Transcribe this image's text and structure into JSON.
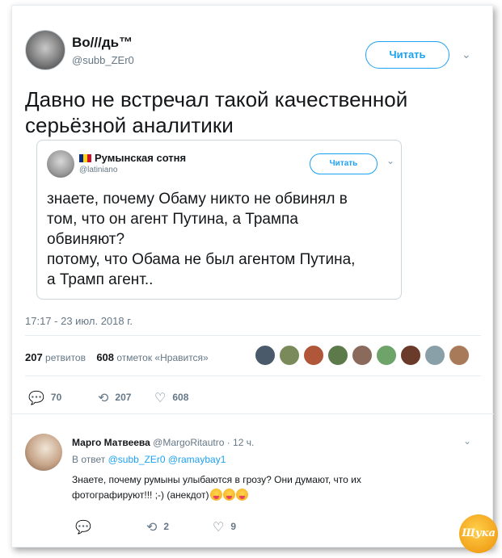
{
  "tweet": {
    "author_name": "Во///дь™",
    "author_handle": "@subb_ZEr0",
    "follow_label": "Читать",
    "text": "Давно не встречал такой качественной серьёзной аналитики",
    "timestamp": "17:17 - 23 июл. 2018 г.",
    "retweets_count": "207",
    "retweets_label": "ретвитов",
    "likes_count": "608",
    "likes_label": "отметок «Нравится»",
    "actions": {
      "reply_count": "70",
      "retweet_count": "207",
      "like_count": "608"
    }
  },
  "quoted": {
    "author_name": "Румынская сотня",
    "author_handle": "@latiniano",
    "follow_label": "Читать",
    "text_line1": "знаете, почему Обаму никто не обвинял в",
    "text_line2": "том, что он агент Путина, а Трампа",
    "text_line3": "обвиняют?",
    "text_line4": "потому, что Обама не был агентом Путина,",
    "text_line5": "а Трамп агент.."
  },
  "reply": {
    "author_name": "Марго Матвеева",
    "author_handle": "@MargoRitautro",
    "time": "· 12 ч.",
    "reply_to_label": "В ответ",
    "reply_to_handles": "@subb_ZEr0 @ramaybay1",
    "text_line1": "Знаете, почему румыны улыбаются в грозу? Они думают, что их",
    "text_line2": "фотографируют!!! ;-) (анекдот)",
    "retweet_count": "2",
    "like_count": "9"
  },
  "watermark": "Щука",
  "colors": {
    "accent": "#1da1f2",
    "muted": "#657786",
    "text": "#14171a",
    "border": "#e6ecf0"
  }
}
